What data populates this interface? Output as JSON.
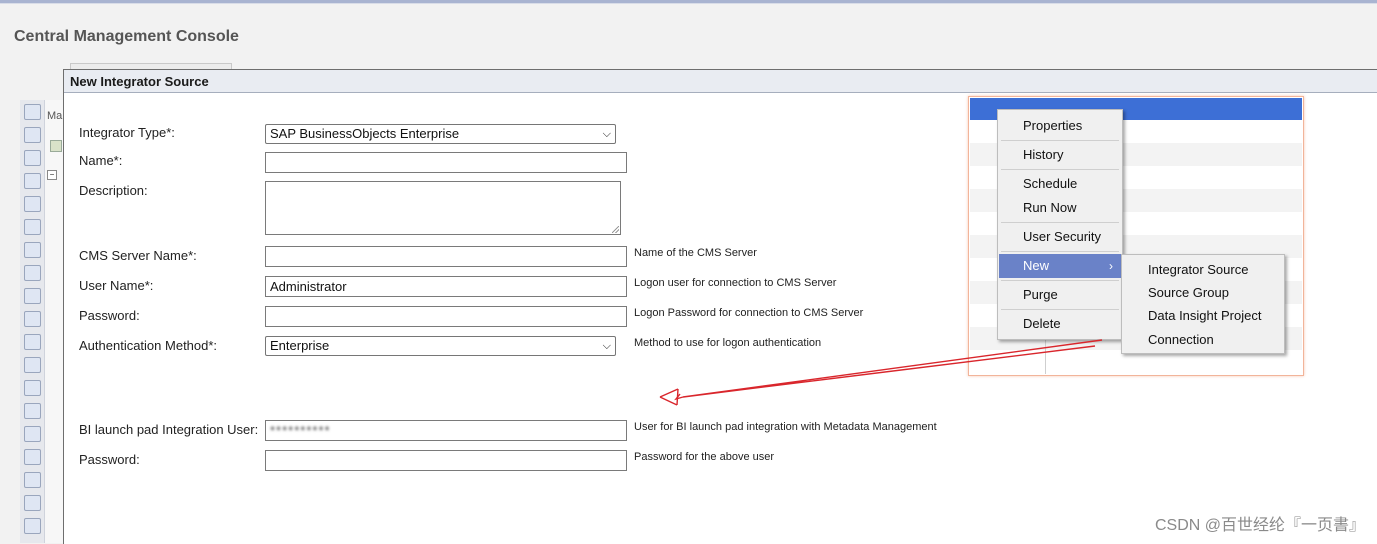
{
  "app": {
    "title": "Central Management Console"
  },
  "dialog": {
    "title": "New Integrator Source",
    "fields": {
      "integrator_type": {
        "label": "Integrator Type*:",
        "value": "SAP BusinessObjects Enterprise"
      },
      "name": {
        "label": "Name*:",
        "value": ""
      },
      "description": {
        "label": "Description:",
        "value": ""
      },
      "cms_server": {
        "label": "CMS Server Name*:",
        "value": "",
        "hint": "Name of the CMS Server"
      },
      "user_name": {
        "label": "User Name*:",
        "value": "Administrator",
        "hint": "Logon user for connection to CMS Server"
      },
      "password": {
        "label": "Password:",
        "value": "",
        "hint": "Logon Password for connection to CMS Server"
      },
      "auth_method": {
        "label": "Authentication Method*:",
        "value": "Enterprise",
        "hint": "Method to use for logon authentication"
      },
      "bi_user": {
        "label": "BI launch pad Integration User:",
        "value": "**********",
        "hint": "User for BI launch pad integration with Metadata Management"
      },
      "bi_password": {
        "label": "Password:",
        "value": "",
        "hint": "Password for the above user"
      }
    }
  },
  "context_menu": {
    "items": [
      "Properties",
      "History",
      "Schedule",
      "Run Now",
      "User Security",
      "New",
      "Purge",
      "Delete"
    ],
    "highlighted": "New",
    "submenu": [
      "Integrator Source",
      "Source Group",
      "Data Insight Project",
      "Connection"
    ]
  },
  "colors": {
    "menu_highlight": "#6a82c8",
    "annotation_arrow": "#d9262c",
    "header_blue": "#3d6fd6"
  },
  "watermark": "CSDN @百世经纶『一页書』"
}
